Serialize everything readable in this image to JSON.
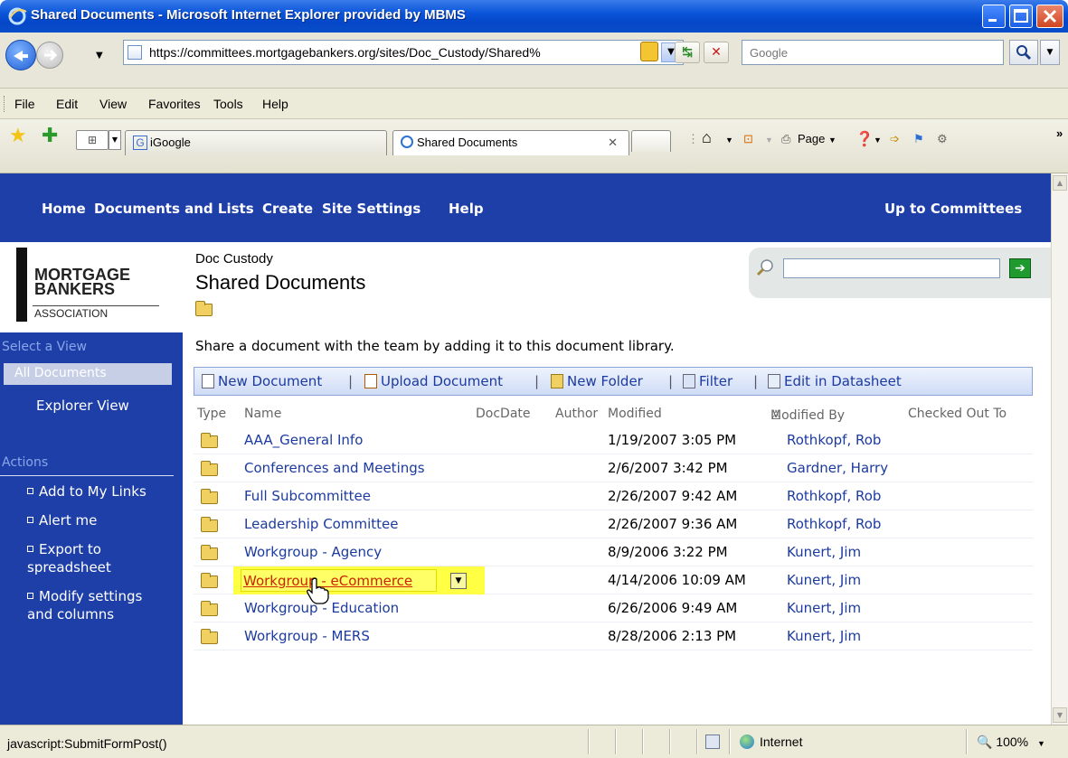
{
  "window": {
    "title": "Shared Documents - Microsoft Internet Explorer provided by MBMS"
  },
  "address": {
    "url": "https://committees.mortgagebankers.org/sites/Doc_Custody/Shared%",
    "search_placeholder": "Google"
  },
  "menu": [
    "File",
    "Edit",
    "View",
    "Favorites",
    "Tools",
    "Help"
  ],
  "tabs": {
    "igoogle": "iGoogle",
    "shared": "Shared Documents"
  },
  "commandbar": {
    "page": "Page"
  },
  "topnav": {
    "items": [
      "Home",
      "Documents and Lists",
      "Create",
      "Site Settings",
      "Help"
    ],
    "up": "Up to Committees"
  },
  "logo": {
    "line1": "MORTGAGE",
    "line2": "BANKERS",
    "line3": "ASSOCIATION"
  },
  "header": {
    "breadcrumb": "Doc Custody",
    "title": "Shared Documents"
  },
  "leftnav": {
    "select_view": "Select a View",
    "views": [
      "All Documents",
      "Explorer View"
    ],
    "actions_header": "Actions",
    "actions": [
      "Add to My Links",
      "Alert me",
      "Export to\nspreadsheet",
      "Modify settings\nand columns"
    ]
  },
  "description": "Share a document with the team by adding it to this document library.",
  "toolbar": {
    "new_document": "New Document",
    "upload_document": "Upload Document",
    "new_folder": "New Folder",
    "filter": "Filter",
    "edit_datasheet": "Edit in Datasheet",
    "sep": "|"
  },
  "columns": {
    "type": "Type",
    "name": "Name",
    "docdate": "DocDate",
    "author": "Author",
    "modified": "Modified",
    "modified_by": "Modified By",
    "checked_out_to": "Checked Out To"
  },
  "rows": [
    {
      "name": "AAA_General Info",
      "modified": "1/19/2007 3:05 PM",
      "by": "Rothkopf, Rob"
    },
    {
      "name": "Conferences and Meetings",
      "modified": "2/6/2007 3:42 PM",
      "by": "Gardner, Harry"
    },
    {
      "name": "Full Subcommittee",
      "modified": "2/26/2007 9:42 AM",
      "by": "Rothkopf, Rob"
    },
    {
      "name": "Leadership Committee",
      "modified": "2/26/2007 9:36 AM",
      "by": "Rothkopf, Rob"
    },
    {
      "name": "Workgroup - Agency",
      "modified": "8/9/2006 3:22 PM",
      "by": "Kunert, Jim"
    },
    {
      "name": "Workgroup - eCommerce",
      "modified": "4/14/2006 10:09 AM",
      "by": "Kunert, Jim"
    },
    {
      "name": "Workgroup - Education",
      "modified": "6/26/2006 9:49 AM",
      "by": "Kunert, Jim"
    },
    {
      "name": "Workgroup - MERS",
      "modified": "8/28/2006 2:13 PM",
      "by": "Kunert, Jim"
    }
  ],
  "status": {
    "text": "javascript:SubmitFormPost()",
    "zone": "Internet",
    "zoom": "100%"
  },
  "colors": {
    "sharepoint_blue": "#1e3fa8",
    "link_blue": "#1c3aa0",
    "highlight": "#ffff44"
  }
}
